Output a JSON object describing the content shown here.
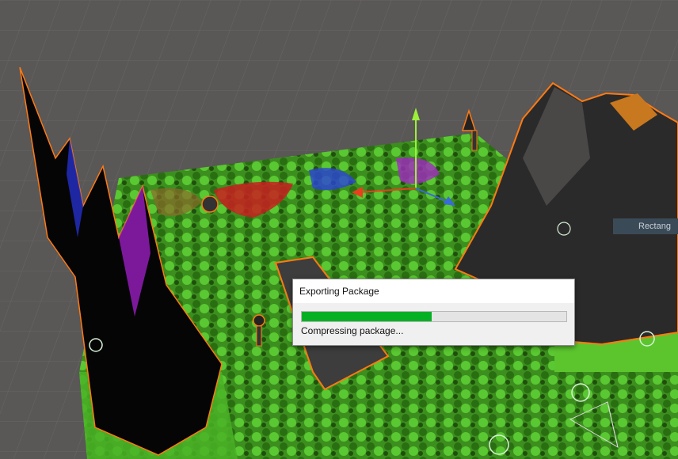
{
  "dialog": {
    "title": "Exporting Package",
    "status": "Compressing package...",
    "progress": 0.49
  },
  "scene": {
    "rect_tool_label": "Rectang"
  },
  "colors": {
    "progress_fill": "#06b025",
    "selection_outline": "#ff7a12",
    "terrain_green": "#4fb52a",
    "grid_bg": "#5a5757"
  }
}
